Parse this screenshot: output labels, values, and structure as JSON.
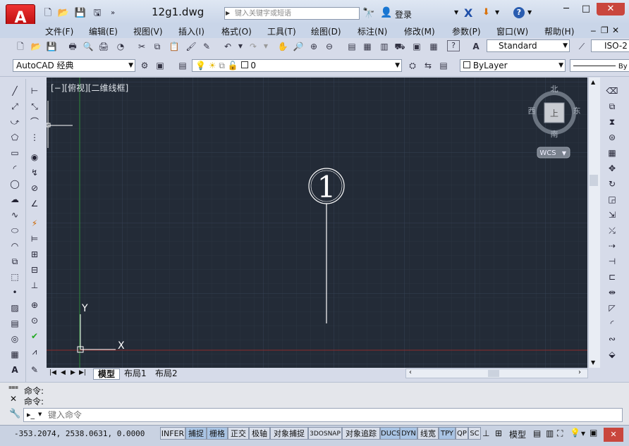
{
  "title_bar": {
    "app_logo": "A",
    "doc_title": "12g1.dwg",
    "search_placeholder": "键入关键字或短语",
    "login": "登录",
    "help": "?",
    "min": "─",
    "max": "□",
    "close": "✕"
  },
  "menu": [
    "文件(F)",
    "编辑(E)",
    "视图(V)",
    "插入(I)",
    "格式(O)",
    "工具(T)",
    "绘图(D)",
    "标注(N)",
    "修改(M)",
    "参数(P)",
    "窗口(W)",
    "帮助(H)"
  ],
  "toolbar": {
    "text_style": "Standard",
    "dim_style": "ISO-2",
    "workspace": "AutoCAD 经典",
    "layer": "0",
    "color": "ByLayer",
    "linetype_label": "By"
  },
  "viewport": {
    "label": "[−][俯视][二维线框]",
    "viewcube_top": "上",
    "north": "北",
    "south": "南",
    "east": "东",
    "west": "西",
    "wcs": "WCS",
    "ucs_x": "X",
    "ucs_y": "Y",
    "balloon_number": "1"
  },
  "tabs": [
    "模型",
    "布局1",
    "布局2"
  ],
  "command": {
    "history": [
      "命令:",
      "命令:"
    ],
    "placeholder": "键入命令"
  },
  "status": {
    "coords": "-353.2074, 2538.0631, 0.0000",
    "buttons": [
      {
        "label": "INFER",
        "on": false
      },
      {
        "label": "捕捉",
        "on": true
      },
      {
        "label": "栅格",
        "on": true
      },
      {
        "label": "正交",
        "on": false
      },
      {
        "label": "极轴",
        "on": false
      },
      {
        "label": "对象捕捉",
        "on": false
      },
      {
        "label": "3DOSNAP",
        "on": false
      },
      {
        "label": "对象追踪",
        "on": false
      },
      {
        "label": "DUCS",
        "on": true
      },
      {
        "label": "DYN",
        "on": true
      },
      {
        "label": "线宽",
        "on": false
      },
      {
        "label": "TPY",
        "on": true
      },
      {
        "label": "QP",
        "on": false
      },
      {
        "label": "SC",
        "on": false
      }
    ],
    "right": {
      "model": "模型"
    }
  },
  "colors": {
    "canvas_bg": "#232b37",
    "grid_minor": "#2b3442",
    "grid_major": "#343f50",
    "y_axis": "#2f8a3b",
    "x_axis": "#8c2b2b",
    "drawing": "#ffffff"
  }
}
